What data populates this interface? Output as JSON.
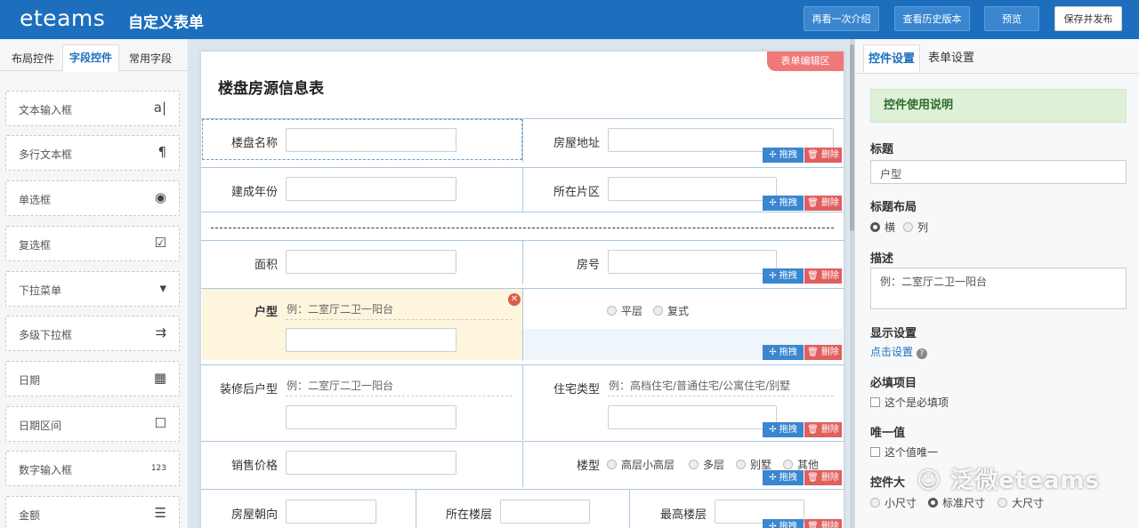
{
  "app": {
    "logo": "eteams",
    "title": "自定义表单"
  },
  "toolbar": {
    "intro": "再看一次介绍",
    "history": "查看历史版本",
    "preview": "预览",
    "save": "保存并发布"
  },
  "left_tabs": [
    "布局控件",
    "字段控件",
    "常用字段"
  ],
  "controls": [
    {
      "label": "文本输入框",
      "icon": "text-input-icon",
      "glyph": "a͏͏͏͏͏͏͏͏͏͏͏͏͏͏͏͏͏͏͏͏͏͏͏͏͏͏͏͏͏͏͏͏͏"
    },
    {
      "label": "多行文本框",
      "icon": "paragraph-icon",
      "glyph": "¶"
    },
    {
      "label": "单选框",
      "icon": "radio-icon",
      "glyph": "◉"
    },
    {
      "label": "复选框",
      "icon": "checkbox-icon",
      "glyph": "☑"
    },
    {
      "label": "下拉菜单",
      "icon": "dropdown-icon",
      "glyph": "▾"
    },
    {
      "label": "多级下拉框",
      "icon": "cascade-icon",
      "glyph": "⇉"
    },
    {
      "label": "日期",
      "icon": "calendar-icon",
      "glyph": "▦"
    },
    {
      "label": "日期区间",
      "icon": "date-range-icon",
      "glyph": "☐"
    },
    {
      "label": "数字输入框",
      "icon": "number-icon",
      "glyph": "123"
    },
    {
      "label": "金额",
      "icon": "coins-icon",
      "glyph": "☰"
    }
  ],
  "form": {
    "badge": "表单编辑区",
    "title": "楼盘房源信息表",
    "drag": "✢ 拖拽",
    "delete": "🗑 删除",
    "f_name": "楼盘名称",
    "f_address": "房屋地址",
    "f_year": "建成年份",
    "f_area_zone": "所在片区",
    "f_area": "面积",
    "f_room": "房号",
    "f_type": "户型",
    "f_type_ph": "例：二室厅二卫一阳台",
    "opt_flat": "平层",
    "opt_duplex": "复式",
    "f_deco_type": "装修后户型",
    "f_deco_ph": "例：二室厅二卫一阳台",
    "f_house_type": "住宅类型",
    "f_house_ph": "例：高档住宅/普通住宅/公寓住宅/别墅",
    "f_price": "销售价格",
    "f_building": "楼型",
    "opt_b1": "高层小高层",
    "opt_b2": "多层",
    "opt_b3": "别墅",
    "opt_b4": "其他",
    "f_orient": "房屋朝向",
    "f_floor": "所在楼层",
    "f_top": "最高楼层"
  },
  "right": {
    "tab_control": "控件设置",
    "tab_form": "表单设置",
    "help": "控件使用说明",
    "title_label": "标题",
    "title_value": "户型",
    "layout_label": "标题布局",
    "layout_h": "横",
    "layout_v": "列",
    "desc_label": "描述",
    "desc_value": "例：二室厅二卫一阳台",
    "display_label": "显示设置",
    "display_link": "点击设置",
    "required_label": "必填项目",
    "required_opt": "这个是必填项",
    "unique_label": "唯一值",
    "unique_opt": "这个值唯一",
    "size_label": "控件大",
    "size_s": "小尺寸",
    "size_m": "标准尺寸",
    "size_l": "大尺寸"
  },
  "watermark": "泛微eteams",
  "colors": {
    "brand": "#1d6fbd",
    "delete": "#e06060",
    "selected_bg": "#fdf5dc"
  }
}
